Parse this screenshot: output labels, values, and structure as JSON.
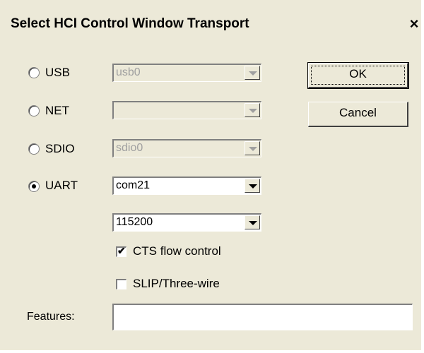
{
  "window": {
    "title": "Select HCI Control Window Transport",
    "close_glyph": "×"
  },
  "transports": [
    {
      "label": "USB",
      "selected": false,
      "value": "usb0",
      "enabled": false
    },
    {
      "label": "NET",
      "selected": false,
      "value": "",
      "enabled": false
    },
    {
      "label": "SDIO",
      "selected": false,
      "value": "sdio0",
      "enabled": false
    },
    {
      "label": "UART",
      "selected": true,
      "value": "com21",
      "enabled": true
    }
  ],
  "baud_rate": "115200",
  "options": {
    "cts": {
      "label": "CTS flow control",
      "checked": true
    },
    "slip": {
      "label": "SLIP/Three-wire",
      "checked": false
    }
  },
  "buttons": {
    "ok": "OK",
    "cancel": "Cancel"
  },
  "features": {
    "label": "Features:",
    "value": ""
  }
}
